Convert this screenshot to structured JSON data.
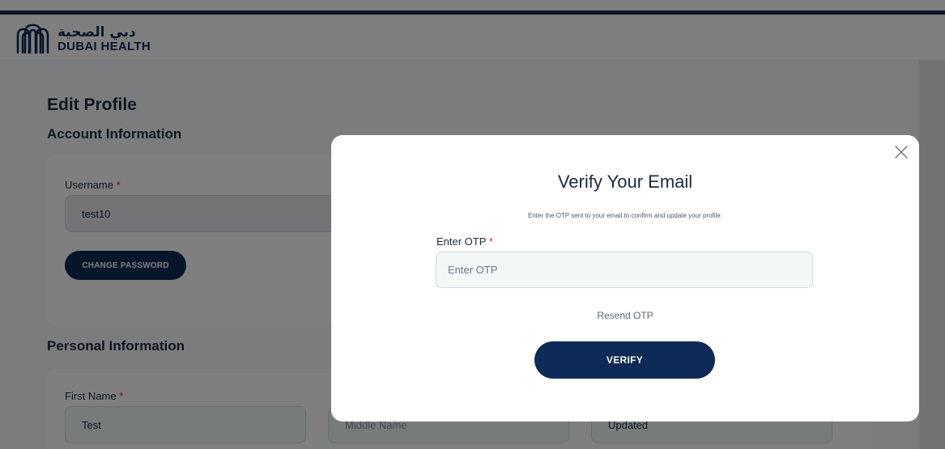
{
  "brand": {
    "arabic_name": "دبي الصحية",
    "english_name": "DUBAI HEALTH",
    "color": "#0e2a56"
  },
  "page": {
    "title": "Edit Profile",
    "account_section_title": "Account Information",
    "personal_section_title": "Personal Information"
  },
  "account": {
    "username_label": "Username",
    "required_mark": "*",
    "username_value": "test10",
    "change_password_label": "CHANGE PASSWORD"
  },
  "personal": {
    "first_name_label": "First Name",
    "first_name_value": "Test",
    "middle_name_placeholder": "Middle Name",
    "last_name_value": "Updated"
  },
  "modal": {
    "title": "Verify Your Email",
    "subtitle": "Enter the OTP sent to your email to confirm and update your profile.",
    "otp_label": "Enter OTP",
    "otp_placeholder": "Enter OTP",
    "otp_value": "",
    "resend_label": "Resend OTP",
    "verify_label": "VERIFY",
    "close_icon": "close-icon"
  },
  "colors": {
    "primary": "#0e2a56",
    "required": "#d9262c",
    "overlay": "rgba(0,0,0,0.5)"
  }
}
